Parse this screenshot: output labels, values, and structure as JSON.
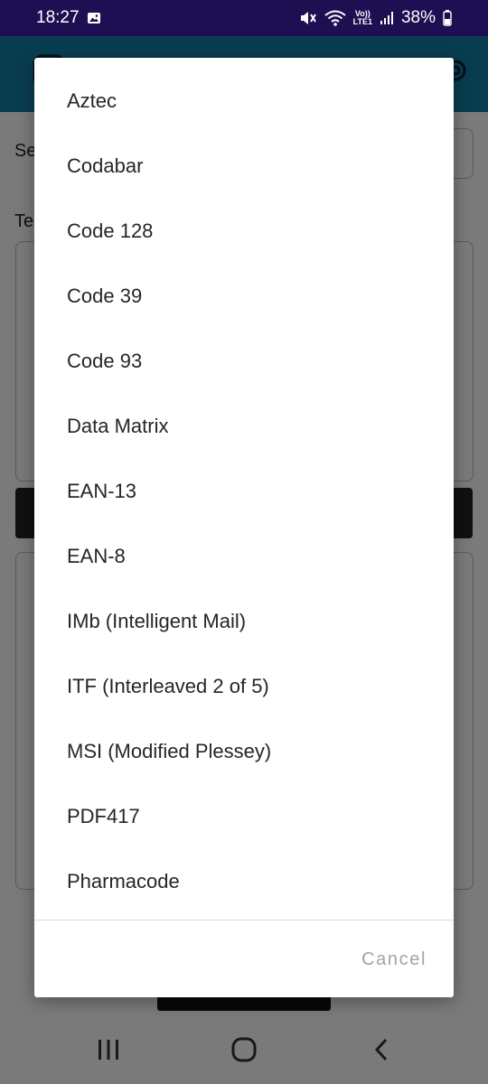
{
  "status_bar": {
    "time": "18:27",
    "volte_line1": "Vo))",
    "volte_line2": "LTE1",
    "battery": "38%",
    "icons": [
      "image-icon",
      "mute-icon",
      "wifi-icon",
      "volte-icon",
      "signal-icon",
      "battery-icon"
    ]
  },
  "app": {
    "label_a": "Se",
    "label_b": "Te",
    "icons": [
      "logo-icon",
      "gear-icon"
    ]
  },
  "dialog": {
    "options": [
      "Aztec",
      "Codabar",
      "Code 128",
      "Code 39",
      "Code 93",
      "Data Matrix",
      "EAN-13",
      "EAN-8",
      "IMb (Intelligent Mail)",
      "ITF (Interleaved 2 of 5)",
      "MSI (Modified Plessey)",
      "PDF417",
      "Pharmacode"
    ],
    "cancel_label": "Cancel"
  },
  "nav_bar": {
    "icons": [
      "recents-icon",
      "home-icon",
      "back-icon"
    ]
  },
  "colors": {
    "status_bar": "#1d0f52",
    "app_bar": "#1180a8",
    "cancel_text": "#a3a3a3"
  }
}
